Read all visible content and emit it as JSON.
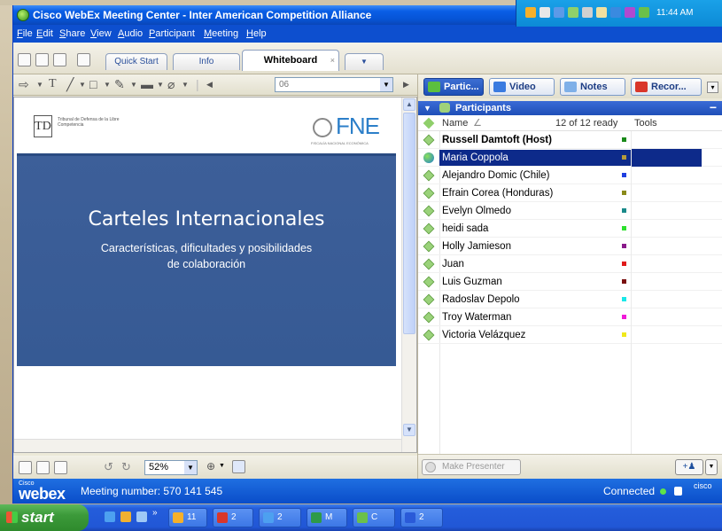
{
  "window": {
    "title": "Cisco WebEx Meeting Center - Inter American Competition Alliance",
    "controls": [
      "minimize",
      "restore",
      "close"
    ]
  },
  "menu": [
    "File",
    "Edit",
    "Share",
    "View",
    "Audio",
    "Participant",
    "Meeting",
    "Help"
  ],
  "tabs": [
    {
      "label": "Quick Start",
      "active": false
    },
    {
      "label": "Info",
      "active": false
    },
    {
      "label": "Whiteboard",
      "active": true
    }
  ],
  "toolbar": {
    "page_value": "06"
  },
  "slide": {
    "logo_left_text": "Tribunal de Defensa de la Libre Competencia",
    "logo_right_text": "FNE",
    "logo_right_sub": "FISCALÍA NACIONAL ECONÓMICA",
    "title": "Carteles Internacionales",
    "subtitle_line1": "Características, dificultades y posibilidades",
    "subtitle_line2": "de colaboración"
  },
  "viewer_bottom": {
    "zoom": "52%"
  },
  "panel_tabs": [
    {
      "label": "Partic...",
      "active": true
    },
    {
      "label": "Video",
      "active": false
    },
    {
      "label": "Notes",
      "active": false
    },
    {
      "label": "Recor...",
      "active": false
    }
  ],
  "participants": {
    "header": "Participants",
    "col_name": "Name",
    "col_status": "12 of 12 ready",
    "col_tools": "Tools",
    "items": [
      {
        "name": "Russell Damtoft (Host)",
        "bold": true,
        "selected": false,
        "color": "#1a8a1a"
      },
      {
        "name": "Maria Coppola",
        "bold": false,
        "selected": true,
        "color": "#b59a3a"
      },
      {
        "name": "Alejandro Domic (Chile)",
        "bold": false,
        "selected": false,
        "color": "#1f3fe0"
      },
      {
        "name": "Efrain Corea (Honduras)",
        "bold": false,
        "selected": false,
        "color": "#8a8a1a"
      },
      {
        "name": "Evelyn Olmedo",
        "bold": false,
        "selected": false,
        "color": "#1a8a8a"
      },
      {
        "name": "heidi sada",
        "bold": false,
        "selected": false,
        "color": "#2ee02e"
      },
      {
        "name": "Holly Jamieson",
        "bold": false,
        "selected": false,
        "color": "#8a1a8a"
      },
      {
        "name": "Juan",
        "bold": false,
        "selected": false,
        "color": "#e01a1a"
      },
      {
        "name": "Luis Guzman",
        "bold": false,
        "selected": false,
        "color": "#7a1010"
      },
      {
        "name": "Radoslav Depolo",
        "bold": false,
        "selected": false,
        "color": "#1ae8e8"
      },
      {
        "name": "Troy Waterman",
        "bold": false,
        "selected": false,
        "color": "#f01ad8"
      },
      {
        "name": "Victoria Velázquez",
        "bold": false,
        "selected": false,
        "color": "#f0e81a"
      }
    ],
    "make_presenter": "Make Presenter"
  },
  "statusbar": {
    "brand": "webex",
    "brand_small": "Cisco",
    "meeting_label": "Meeting number: 570 141 545",
    "connection": "Connected",
    "cisco": "cisco"
  },
  "taskbar": {
    "start": "start",
    "buttons": [
      {
        "label": "11",
        "icon": "webex-icon"
      },
      {
        "label": "2",
        "icon": "pdf-icon"
      },
      {
        "label": "2",
        "icon": "ie-icon"
      },
      {
        "label": "M",
        "icon": "excel-icon"
      },
      {
        "label": "C",
        "icon": "webex-meeting-icon"
      },
      {
        "label": "2",
        "icon": "word-icon"
      }
    ],
    "clock": "11:44 AM"
  }
}
